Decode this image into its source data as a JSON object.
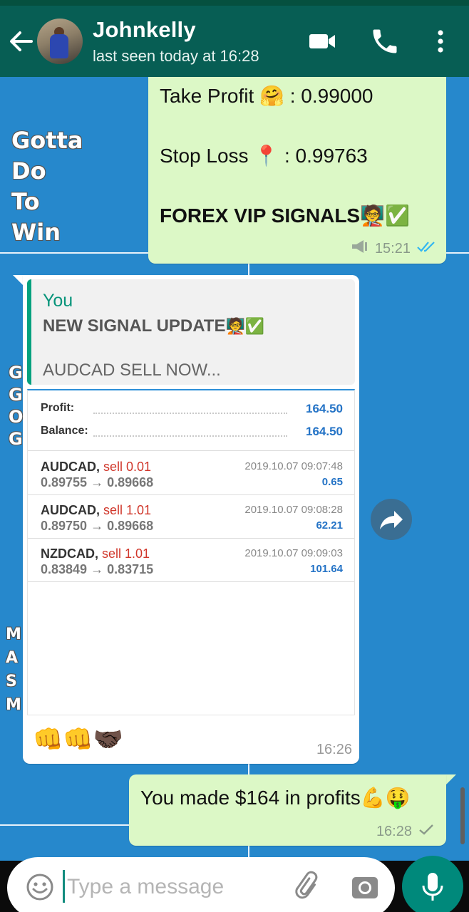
{
  "colors": {
    "header": "#075e54",
    "accent": "#06947a",
    "outgoing_bubble": "#dcf8c6",
    "read_tick": "#34b7f1",
    "loss": "#d0362a",
    "profit": "#2473c6"
  },
  "header": {
    "contact_name": "Johnkelly",
    "last_seen": "last seen today at 16:28",
    "icons": [
      "back-arrow-icon",
      "video-call-icon",
      "phone-icon",
      "more-options-icon"
    ]
  },
  "wallpaper": {
    "lines": [
      "Gotta",
      "Do",
      "To",
      "Win"
    ],
    "fragments_1": [
      "G",
      "G",
      "O",
      "G"
    ],
    "fragments_2": [
      "M",
      "A",
      "S",
      "M"
    ]
  },
  "messages": [
    {
      "direction": "outgoing",
      "tp_label": "Take Profit",
      "tp_value": ": 0.99000",
      "sl_label": "Stop Loss",
      "sl_value": ": 0.99763",
      "signal_title": "FOREX VIP SIGNALS",
      "time": "15:21",
      "status": "read"
    },
    {
      "direction": "incoming",
      "quote": {
        "author": "You",
        "title": "NEW SIGNAL UPDATE",
        "text": "AUDCAD SELL NOW..."
      },
      "screenshot": {
        "profit_label": "Profit:",
        "profit_value": "164.50",
        "balance_label": "Balance:",
        "balance_value": "164.50",
        "trades": [
          {
            "symbol": "AUDCAD,",
            "side": "sell 0.01",
            "open": "0.89755",
            "arrow": "→",
            "close": "0.89668",
            "time": "2019.10.07 09:07:48",
            "pl": "0.65"
          },
          {
            "symbol": "AUDCAD,",
            "side": "sell 1.01",
            "open": "0.89750",
            "arrow": "→",
            "close": "0.89668",
            "time": "2019.10.07 09:08:28",
            "pl": "62.21"
          },
          {
            "symbol": "NZDCAD,",
            "side": "sell 1.01",
            "open": "0.83849",
            "arrow": "→",
            "close": "0.83715",
            "time": "2019.10.07 09:09:03",
            "pl": "101.64"
          }
        ]
      },
      "reactions": "👊👊🤝🏿",
      "time": "16:26"
    },
    {
      "direction": "outgoing",
      "text": "You made $164 in profits💪🤑",
      "time": "16:28",
      "status": "sent"
    }
  ],
  "composer": {
    "placeholder": "Type a message",
    "icons": [
      "emoji-icon",
      "attach-icon",
      "camera-icon",
      "mic-icon"
    ]
  }
}
